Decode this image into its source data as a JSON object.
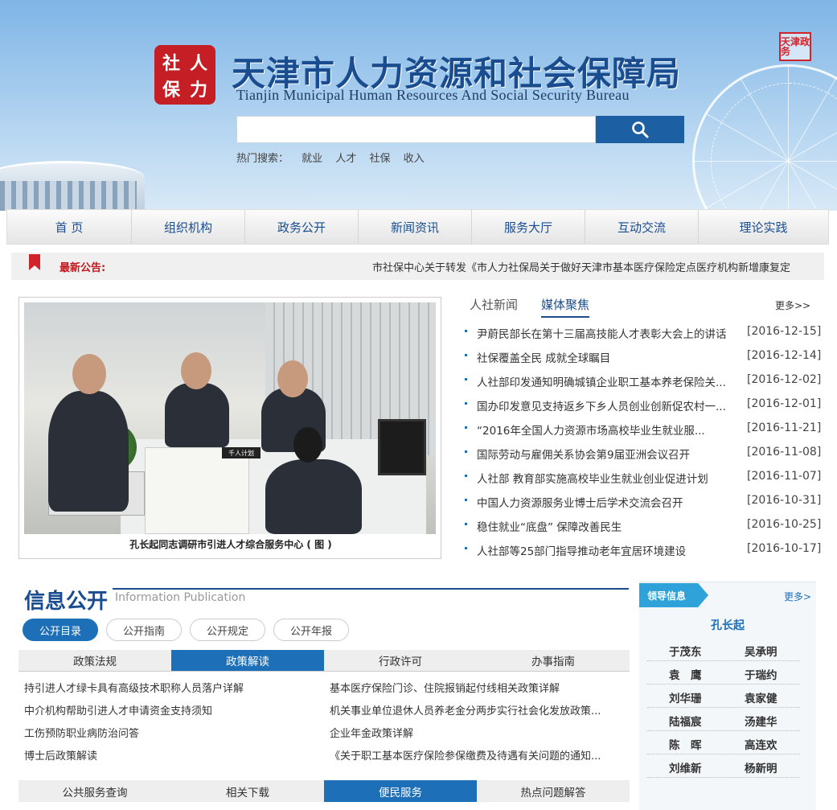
{
  "header": {
    "logo_seal_chars": [
      "社",
      "人",
      "保",
      "力"
    ],
    "title_cn": "天津市人力资源和社会保障局",
    "title_en": "Tianjin Municipal Human Resources And Social Security Bureau",
    "corner_seal": "天津政务",
    "search": {
      "placeholder": "",
      "button_icon": "search-icon"
    },
    "hot_label": "热门搜索：",
    "hot_terms": [
      "就业",
      "人才",
      "社保",
      "收入"
    ]
  },
  "nav": [
    "首 页",
    "组织机构",
    "政务公开",
    "新闻资讯",
    "服务大厅",
    "互动交流",
    "理论实践"
  ],
  "notice": {
    "label": "最新公告:",
    "text": "市社保中心关于转发《市人力社保局关于做好天津市基本医疗保险定点医疗机构新增康复定"
  },
  "feature_photo": {
    "caption": "孔长起同志调研市引进人才综合服务中心 ( 图 )",
    "sign_text": "千人计划"
  },
  "news": {
    "tabs": [
      "人社新闻",
      "媒体聚焦"
    ],
    "active_tab": 1,
    "more": "更多>>",
    "items": [
      {
        "title": "尹蔚民部长在第十三届高技能人才表彰大会上的讲话",
        "date": "[2016-12-15]"
      },
      {
        "title": "社保覆盖全民 成就全球瞩目",
        "date": "[2016-12-14]"
      },
      {
        "title": "人社部印发通知明确城镇企业职工基本养老保险关...",
        "date": "[2016-12-02]"
      },
      {
        "title": "国办印发意见支持返乡下乡人员创业创新促农村一...",
        "date": "[2016-12-01]"
      },
      {
        "title": "“2016年全国人力资源市场高校毕业生就业服...",
        "date": "[2016-11-21]"
      },
      {
        "title": "国际劳动与雇佣关系协会第9届亚洲会议召开",
        "date": "[2016-11-08]"
      },
      {
        "title": "人社部 教育部实施高校毕业生就业创业促进计划",
        "date": "[2016-11-07]"
      },
      {
        "title": "中国人力资源服务业博士后学术交流会召开",
        "date": "[2016-10-31]"
      },
      {
        "title": "稳住就业“底盘” 保障改善民生",
        "date": "[2016-10-25]"
      },
      {
        "title": "人社部等25部门指导推动老年宜居环境建设",
        "date": "[2016-10-17]"
      }
    ]
  },
  "info": {
    "title": "信息公开",
    "subtitle": "Information Publication",
    "pills": [
      "公开目录",
      "公开指南",
      "公开规定",
      "公开年报"
    ],
    "active_pill": 0,
    "tabs": [
      "政策法规",
      "政策解读",
      "行政许可",
      "办事指南"
    ],
    "active_tab": 1,
    "links_left": [
      "持引进人才绿卡具有高级技术职称人员落户详解",
      "中介机构帮助引进人才申请资金支持须知",
      "工伤预防职业病防治问答",
      "博士后政策解读"
    ],
    "links_right": [
      "基本医疗保险门诊、住院报销起付线相关政策详解",
      "机关事业单位退休人员养老金分两步实行社会化发放政策...",
      "企业年金政策详解",
      "《关于职工基本医疗保险参保缴费及待遇有关问题的通知..."
    ],
    "tabs2": [
      "公共服务查询",
      "相关下载",
      "便民服务",
      "热点问题解答"
    ],
    "active_tab2": 2
  },
  "leaders": {
    "tag": "领导信息",
    "more": "更多>",
    "chief": "孔长起",
    "rows": [
      [
        "于茂东",
        "吴承明"
      ],
      [
        "袁　鹰",
        "于瑞约"
      ],
      [
        "刘华珊",
        "袁家健"
      ],
      [
        "陆福宸",
        "汤建华"
      ],
      [
        "陈　晖",
        "高连欢"
      ],
      [
        "刘维新",
        "杨新明"
      ]
    ]
  },
  "colors": {
    "brand_blue": "#1a4d8f",
    "accent_blue": "#1d6fb8",
    "notice_red": "#c4161c",
    "leader_tag": "#2fa2d9"
  }
}
